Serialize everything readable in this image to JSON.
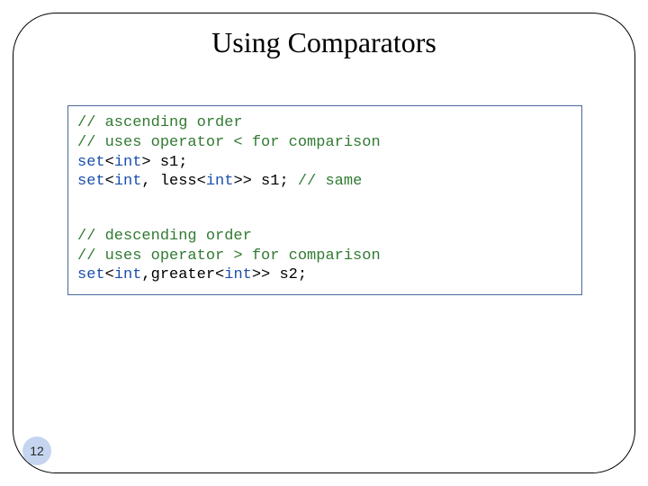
{
  "slide": {
    "title": "Using Comparators",
    "page_number": "12"
  },
  "code": {
    "c1": "// ascending order",
    "c2": "// uses operator < for comparison",
    "l3_a": "set",
    "l3_b": "<",
    "l3_c": "int",
    "l3_d": "> s1;",
    "l4_a": "set",
    "l4_b": "<",
    "l4_c": "int",
    "l4_d": ", less<",
    "l4_e": "int",
    "l4_f": ">> s1; ",
    "l4_g": "// same",
    "c5": "// descending order",
    "c6": "// uses operator > for comparison",
    "l7_a": "set",
    "l7_b": "<",
    "l7_c": "int",
    "l7_d": ",greater<",
    "l7_e": "int",
    "l7_f": ">> s2;"
  }
}
